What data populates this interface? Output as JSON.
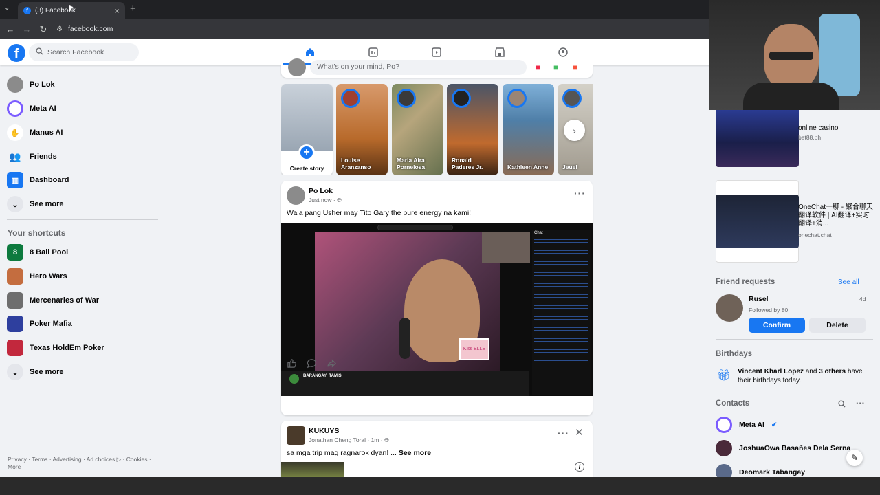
{
  "browser": {
    "tab_title": "(3) Facebook",
    "url": "facebook.com"
  },
  "facebook": {
    "search_placeholder": "Search Facebook",
    "brand_color": "#1877f2"
  },
  "sidebar": {
    "items": [
      {
        "label": "Po Lok",
        "icon": "profile-avatar"
      },
      {
        "label": "Meta AI",
        "icon": "meta-ai-icon"
      },
      {
        "label": "Manus AI",
        "icon": "manus-ai-icon"
      },
      {
        "label": "Friends",
        "icon": "friends-icon"
      },
      {
        "label": "Dashboard",
        "icon": "dashboard-icon"
      },
      {
        "label": "See more",
        "icon": "chevron-down-icon"
      }
    ],
    "shortcuts_title": "Your shortcuts",
    "shortcuts": [
      {
        "label": "8 Ball Pool"
      },
      {
        "label": "Hero Wars"
      },
      {
        "label": "Mercenaries of War"
      },
      {
        "label": "Poker Mafia"
      },
      {
        "label": "Texas HoldEm Poker"
      },
      {
        "label": "See more"
      }
    ],
    "footer": {
      "privacy": "Privacy",
      "terms": "Terms",
      "advertising": "Advertising",
      "ad_choices": "Ad choices",
      "cookies": "Cookies",
      "more": "More"
    }
  },
  "composer": {
    "placeholder": "What's on your mind, Po?"
  },
  "stories": [
    {
      "name": "Create story"
    },
    {
      "name": "Louise Aranzanso"
    },
    {
      "name": "Maria Aira Pornelosa"
    },
    {
      "name": "Ronald Paderes Jr."
    },
    {
      "name": "Kathleen Anne"
    },
    {
      "name": "Jeuel"
    }
  ],
  "posts": [
    {
      "author": "Po Lok",
      "meta": "Just now ·",
      "text": "Wala pang Usher may Tito Gary the pure energy na kami!",
      "video": {
        "chat_title": "Chat",
        "streamer": "BARANGAY_TAMIS",
        "pip_caption": "Kiss ELLE"
      }
    },
    {
      "author": "KUKUYS",
      "meta": "Jonathan Cheng Toral · 1m ·",
      "text": "sa mga trip mag ragnarok dyan! ...",
      "see_more": "See more"
    }
  ],
  "right_rail": {
    "ads": [
      {
        "title": "online casino",
        "url": "bet88.ph"
      },
      {
        "title": "OneChat一聊 - 聚合聊天翻译软件 | AI翻译+实时翻译+消...",
        "url": "onechat.chat"
      }
    ],
    "friend_requests": {
      "title": "Friend requests",
      "see_all": "See all",
      "name": "Rusel",
      "mutual": "Followed by 80",
      "time": "4d",
      "confirm": "Confirm",
      "delete": "Delete"
    },
    "birthdays": {
      "title": "Birthdays",
      "name": "Vincent Kharl Lopez",
      "and": "and",
      "others": "3 others",
      "suffix": "have their birthdays today."
    },
    "contacts": {
      "title": "Contacts",
      "items": [
        {
          "name": "Meta AI"
        },
        {
          "name": "JoshuaOwa Basañes Dela Serna"
        },
        {
          "name": "Deomark Tabangay"
        }
      ]
    }
  }
}
